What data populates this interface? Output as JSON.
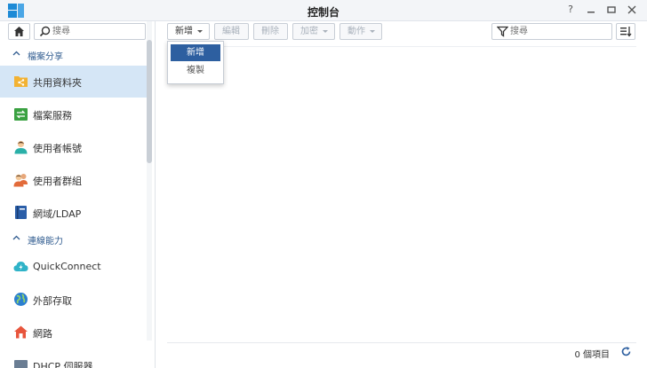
{
  "window": {
    "title": "控制台"
  },
  "sidebar": {
    "search_placeholder": "搜尋",
    "sections": [
      {
        "label": "檔案分享"
      },
      {
        "label": "連線能力"
      }
    ],
    "items": [
      {
        "label": "共用資料夾",
        "icon": "shared-folder-icon",
        "active": true
      },
      {
        "label": "檔案服務",
        "icon": "file-services-icon"
      },
      {
        "label": "使用者帳號",
        "icon": "user-icon"
      },
      {
        "label": "使用者群組",
        "icon": "group-icon"
      },
      {
        "label": "網域/LDAP",
        "icon": "domain-ldap-icon"
      },
      {
        "label": "QuickConnect",
        "icon": "quickconnect-icon"
      },
      {
        "label": "外部存取",
        "icon": "external-access-icon"
      },
      {
        "label": "網路",
        "icon": "network-icon"
      },
      {
        "label": "DHCP 伺服器",
        "icon": "dhcp-server-icon"
      }
    ]
  },
  "toolbar": {
    "create_label": "新增",
    "edit_label": "編輯",
    "delete_label": "刪除",
    "encrypt_label": "加密",
    "action_label": "動作",
    "filter_placeholder": "搜尋"
  },
  "dropdown": {
    "items": [
      "新增",
      "複製"
    ]
  },
  "status": {
    "count": "0 個項目"
  },
  "colors": {
    "accent": "#2d5fa0",
    "active_bg": "#d5e6f6",
    "section_text": "#2f5b8f"
  }
}
